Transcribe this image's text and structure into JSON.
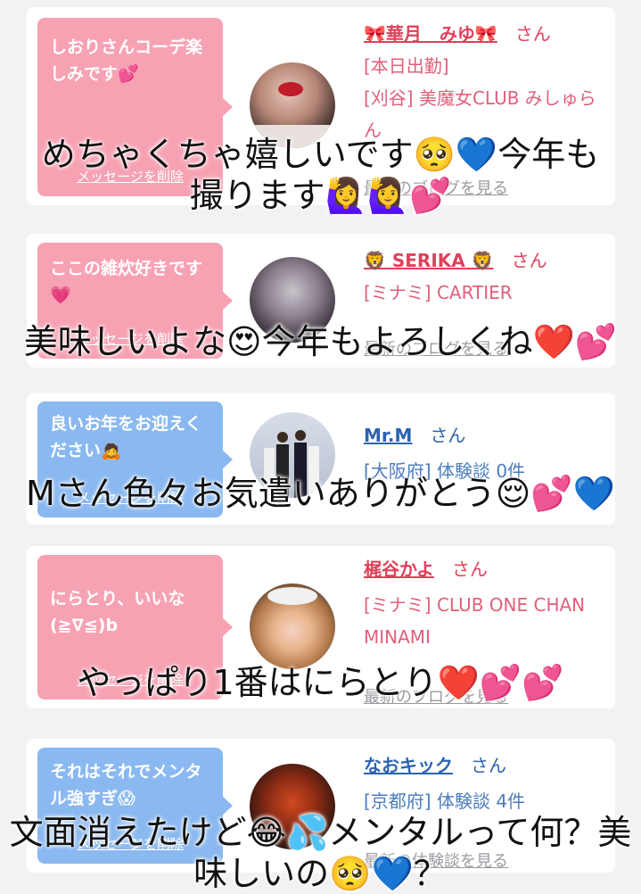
{
  "cards": [
    {
      "bubble": {
        "text": "しおりさんコーデ楽しみです💕",
        "color": "pink",
        "delete_label": "メッセージを削除"
      },
      "name": "🎀華月　みゆ🎀",
      "honorific": "さん",
      "lines": [
        "[本日出勤]",
        "[刈谷] 美魔女CLUB みしゅらん"
      ],
      "link": "最新のブログを見る",
      "overlay": "めちゃくちゃ嬉しいです🥺💙今年も撮ります🙋‍♀️🙋‍♀️💕"
    },
    {
      "bubble": {
        "text": "ここの雑炊好きです💗",
        "color": "pink",
        "delete_label": "メッセージを削除"
      },
      "name": "🦁 SERIKA 🦁",
      "honorific": "さん",
      "lines": [
        "[ミナミ] CARTIER"
      ],
      "link": "最新のブログを見る",
      "overlay": "美味しいよな😍今年もよろしくね❤️💕"
    },
    {
      "bubble": {
        "text": "良いお年をお迎えください🙇",
        "color": "blue",
        "delete_label": "メッセージを削除"
      },
      "name": "Mr.M",
      "honorific": "さん",
      "lines": [
        "[大阪府] 体験談 0件"
      ],
      "link": "",
      "overlay": "Mさん色々お気遣いありがとう😌💕💙"
    },
    {
      "bubble": {
        "text": "にらとり、いいな(≧∇≦)b",
        "color": "pink",
        "delete_label": "メッセージを削除"
      },
      "name": "梶谷かよ",
      "honorific": "さん",
      "lines": [
        "[ミナミ] CLUB ONE CHAN MINAMI"
      ],
      "link": "最新のブログを見る",
      "overlay": "やっぱり1番はにらとり❤️💕💕"
    },
    {
      "bubble": {
        "text": "それはそれでメンタル強すぎ😱",
        "color": "blue",
        "delete_label": "メッセージを削除"
      },
      "name": "なおキック",
      "honorific": "さん",
      "lines": [
        "[京都府] 体験談 4件"
      ],
      "link": "最新の体験談を見る",
      "overlay": "文面消えたけど😂💦メンタルって何？美味しいの🥺💙？"
    }
  ]
}
